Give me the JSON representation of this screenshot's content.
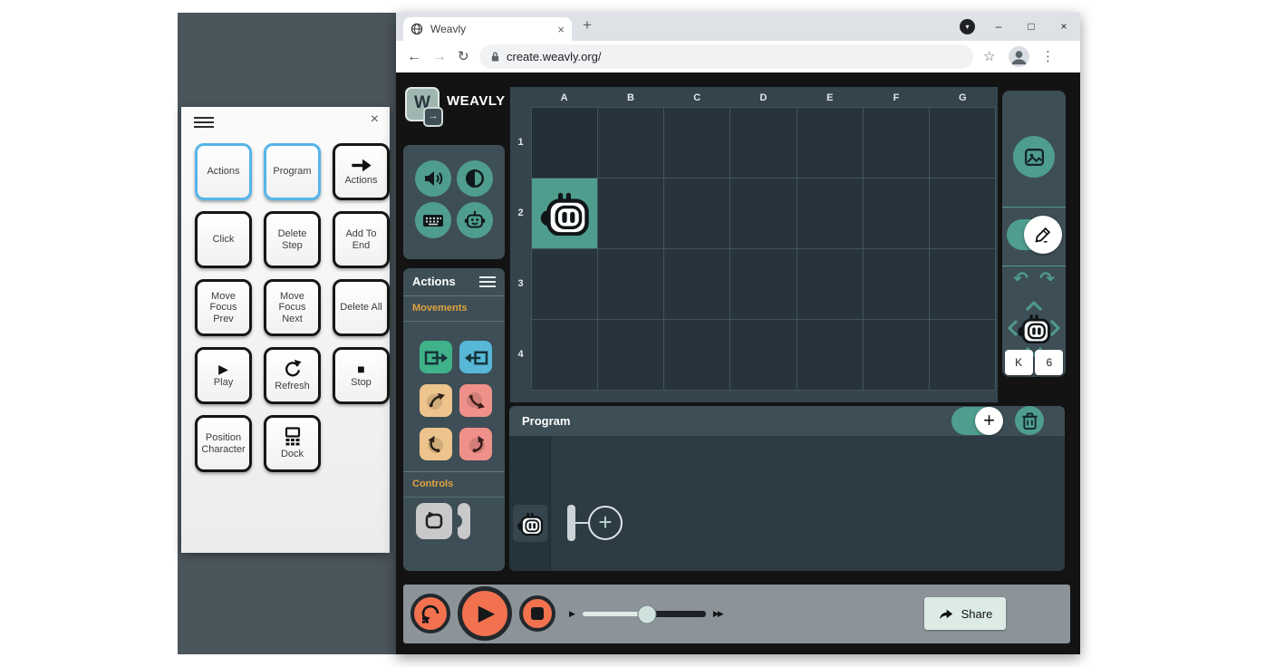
{
  "browser": {
    "tab_title": "Weavly",
    "url": "create.weavly.org/"
  },
  "icons": {
    "close": "×",
    "minimize": "–",
    "maximize": "□",
    "menu_dots": "⋮",
    "star": "☆",
    "back": "←",
    "forward": "→",
    "reload": "↻",
    "new_tab": "+",
    "media_chevron": "▾",
    "plus": "+",
    "play": "▶",
    "stop": "■",
    "speed_slow": "▶",
    "speed_fast": "▶▶",
    "undo": "↶",
    "redo": "↷",
    "logo_arrow": "→"
  },
  "remote_panel": {
    "buttons": [
      {
        "label": "Actions"
      },
      {
        "label": "Program"
      },
      {
        "label": "Actions"
      },
      {
        "label": "Click"
      },
      {
        "label": "Delete Step"
      },
      {
        "label": "Add To End"
      },
      {
        "label": "Move Focus Prev"
      },
      {
        "label": "Move Focus Next"
      },
      {
        "label": "Delete All"
      },
      {
        "label": "Play"
      },
      {
        "label": "Refresh"
      },
      {
        "label": "Stop"
      },
      {
        "label": "Position Character"
      },
      {
        "label": "Dock"
      }
    ]
  },
  "app": {
    "brand": "WEAVLY",
    "logo_letter": "W",
    "palette": {
      "title": "Actions",
      "movements_label": "Movements",
      "controls_label": "Controls"
    },
    "scene": {
      "columns": [
        "A",
        "B",
        "C",
        "D",
        "E",
        "F",
        "G"
      ],
      "rows": [
        "1",
        "2",
        "3",
        "4"
      ],
      "character_cell": "A2"
    },
    "position_inputs": {
      "x": "K",
      "y": "6"
    },
    "program": {
      "title": "Program"
    },
    "share_label": "Share"
  },
  "colors": {
    "accent_teal": "#4f9d8e",
    "button_orange": "#f2714e",
    "section_label_orange": "#e0a33e",
    "block_green": "#3fb28a",
    "block_blue": "#57b7d6",
    "block_tan": "#eec48d",
    "block_salmon": "#f0908a",
    "focus_blue": "#56b5e8",
    "desktop_gray": "#4b555c"
  }
}
